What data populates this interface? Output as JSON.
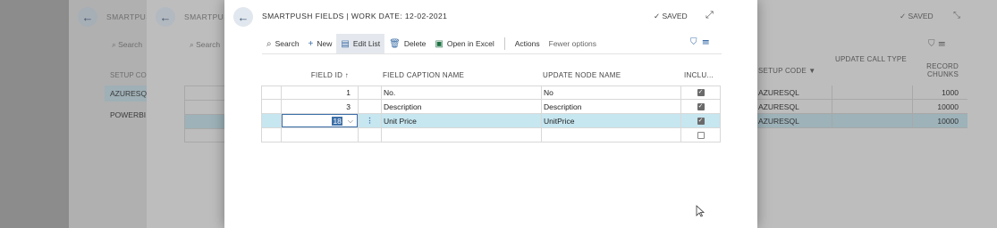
{
  "background": {
    "layer1": {
      "title": "SMARTPUSH",
      "search_label": "Search",
      "column_header": "SETUP COD",
      "items": [
        "AZURESQL",
        "POWERBI"
      ]
    },
    "layer2": {
      "title": "SMARTPUSH",
      "search_label": "Search"
    },
    "right": {
      "saved_label": "SAVED",
      "columns": [
        "SETUP CODE",
        "UPDATE CALL TYPE",
        "RECORD CHUNKS"
      ],
      "rows": [
        {
          "setup_code": "AZURESQL",
          "chunks": "1000"
        },
        {
          "setup_code": "AZURESQL",
          "chunks": "10000"
        },
        {
          "setup_code": "AZURESQL",
          "chunks": "10000"
        }
      ]
    }
  },
  "dialog": {
    "title": "SMARTPUSH FIELDS | WORK DATE: 12-02-2021",
    "saved_label": "SAVED",
    "toolbar": {
      "search": "Search",
      "new": "New",
      "edit_list": "Edit List",
      "delete": "Delete",
      "open_in_excel": "Open in Excel",
      "actions": "Actions",
      "fewer_options": "Fewer options"
    },
    "grid": {
      "headers": {
        "field_id": "FIELD ID ↑",
        "caption": "FIELD CAPTION NAME",
        "node": "UPDATE NODE NAME",
        "include": "INCLU..."
      },
      "rows": [
        {
          "field_id": "1",
          "caption": "No.",
          "node": "No",
          "include": true
        },
        {
          "field_id": "3",
          "caption": "Description",
          "node": "Description",
          "include": true
        },
        {
          "field_id": "18",
          "caption": "Unit Price",
          "node": "UnitPrice",
          "include": true
        },
        {
          "field_id": "",
          "caption": "",
          "node": "",
          "include": false
        }
      ]
    }
  },
  "colors": {
    "accent": "#3d6fa8",
    "selected_row": "#c6e6f0",
    "overlay": "#8c8c8c"
  },
  "icons": [
    "back-arrow-icon",
    "search-icon",
    "plus-icon",
    "edit-list-icon",
    "trash-icon",
    "excel-icon",
    "filter-icon",
    "list-icon",
    "checkmark-icon",
    "expand-icon",
    "collapse-icon",
    "dropdown-chevron-icon",
    "row-menu-icon",
    "mouse-pointer-icon"
  ]
}
